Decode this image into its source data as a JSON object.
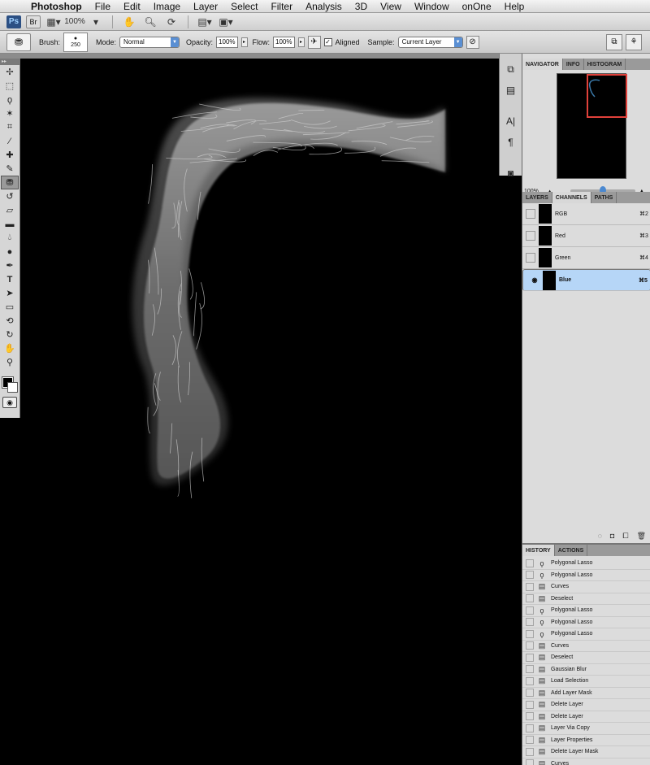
{
  "menubar": {
    "apple_icon": "apple-icon",
    "app_name": "Photoshop",
    "items": [
      "File",
      "Edit",
      "Image",
      "Layer",
      "Select",
      "Filter",
      "Analysis",
      "3D",
      "View",
      "Window",
      "onOne",
      "Help"
    ]
  },
  "appbar": {
    "ps_logo": "Ps",
    "bridge_label": "Br",
    "zoom": "100%"
  },
  "options": {
    "brush_label": "Brush:",
    "brush_size": "250",
    "mode_label": "Mode:",
    "mode_value": "Normal",
    "opacity_label": "Opacity:",
    "opacity_value": "100%",
    "flow_label": "Flow:",
    "flow_value": "100%",
    "aligned_label": "Aligned",
    "aligned_checked": "✓",
    "sample_label": "Sample:",
    "sample_value": "Current Layer"
  },
  "navigator": {
    "tabs": [
      "NAVIGATOR",
      "INFO",
      "HISTOGRAM"
    ],
    "zoom": "100%"
  },
  "channels": {
    "tabs": [
      "LAYERS",
      "CHANNELS",
      "PATHS"
    ],
    "rows": [
      {
        "name": "RGB",
        "key": "⌘2"
      },
      {
        "name": "Red",
        "key": "⌘3"
      },
      {
        "name": "Green",
        "key": "⌘4"
      },
      {
        "name": "Blue",
        "key": "⌘5"
      }
    ]
  },
  "history": {
    "tabs": [
      "HISTORY",
      "ACTIONS"
    ],
    "items": [
      "Polygonal Lasso",
      "Polygonal Lasso",
      "Curves",
      "Deselect",
      "Polygonal Lasso",
      "Polygonal Lasso",
      "Polygonal Lasso",
      "Curves",
      "Deselect",
      "Gaussian Blur",
      "Load Selection",
      "Add Layer Mask",
      "Delete Layer",
      "Delete Layer",
      "Layer Via Copy",
      "Layer Properties",
      "Delete Layer Mask",
      "Curves"
    ]
  },
  "colors": {
    "selection": "#b6d6f7",
    "accent": "#4a88d0",
    "nav_rect": "#e0413b"
  }
}
